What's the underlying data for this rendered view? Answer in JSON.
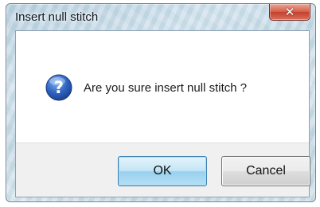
{
  "window": {
    "title": "Insert null stitch",
    "close_icon": "close-icon"
  },
  "dialog": {
    "icon": "question-icon",
    "message": "Are you sure insert null stitch ?"
  },
  "buttons": {
    "ok_label": "OK",
    "cancel_label": "Cancel"
  },
  "colors": {
    "close_button": "#d7604c",
    "ok_button_border": "#3c7fb1",
    "question_icon": "#2456b0"
  }
}
